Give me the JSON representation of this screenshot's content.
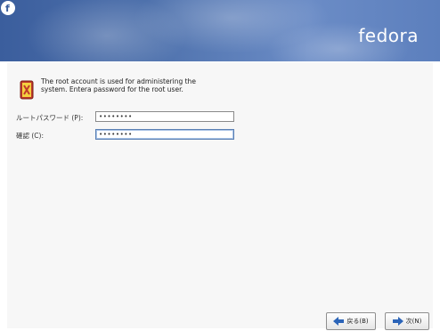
{
  "header": {
    "brand": "fedora"
  },
  "root": {
    "description": "The root account is used for administering the system. Entera password for the root user.",
    "password_label": "ルートパスワード (P):",
    "password_value": "••••••••",
    "confirm_label": "確認 (C):",
    "confirm_value": "••••••••"
  },
  "nav": {
    "back_label": "戻る(B)",
    "next_label": "次(N)"
  }
}
